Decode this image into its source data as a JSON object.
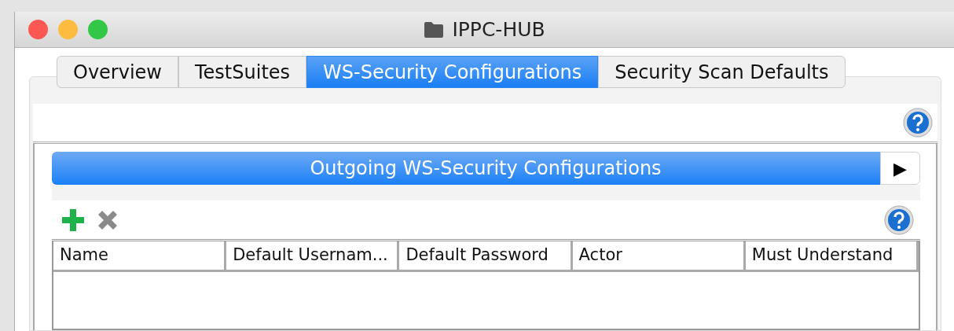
{
  "window": {
    "title": "IPPC-HUB"
  },
  "tabs": [
    {
      "label": "Overview",
      "selected": false
    },
    {
      "label": "TestSuites",
      "selected": false
    },
    {
      "label": "WS-Security Configurations",
      "selected": true
    },
    {
      "label": "Security Scan Defaults",
      "selected": false
    }
  ],
  "section": {
    "title": "Outgoing WS-Security Configurations",
    "expand_button": "▶"
  },
  "toolbar": {
    "add_disabled": false,
    "remove_disabled": true
  },
  "table": {
    "columns": [
      "Name",
      "Default Usernam...",
      "Default Password",
      "Actor",
      "Must Understand"
    ]
  }
}
